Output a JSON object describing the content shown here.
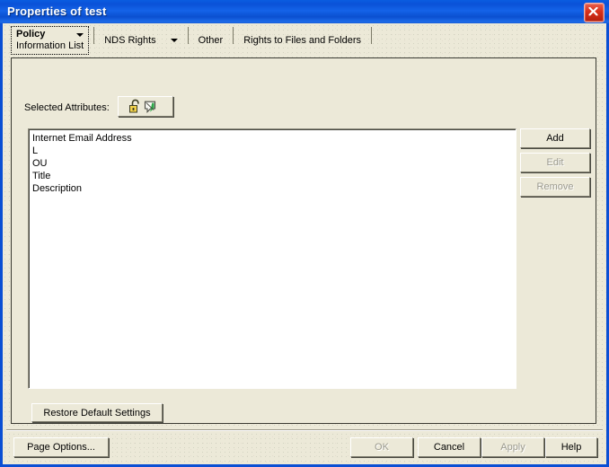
{
  "window": {
    "title": "Properties of test",
    "close_icon": "close-icon",
    "titlebar_color": "#0a52d8",
    "face_color": "#ece9d8"
  },
  "tabs": [
    {
      "label": "Policy",
      "sublabel": "Information List",
      "selected": true,
      "has_dropdown": true
    },
    {
      "label": "NDS Rights",
      "sublabel": "",
      "selected": false,
      "has_dropdown": true
    },
    {
      "label": "Other",
      "sublabel": "",
      "selected": false,
      "has_dropdown": false
    },
    {
      "label": "Rights to Files and Folders",
      "sublabel": "",
      "selected": false,
      "has_dropdown": false
    }
  ],
  "page": {
    "attributes_label": "Selected Attributes:",
    "attributes_icon": "unlocked-padlock-and-trustee-icon",
    "list_items": [
      "Internet Email Address",
      "L",
      "OU",
      "Title",
      "Description"
    ],
    "side_buttons": [
      {
        "label": "Add",
        "enabled": true
      },
      {
        "label": "Edit",
        "enabled": false
      },
      {
        "label": "Remove",
        "enabled": false
      }
    ],
    "restore_button": {
      "label": "Restore Default Settings",
      "enabled": true
    }
  },
  "footer": {
    "buttons": [
      {
        "label": "Page Options...",
        "enabled": true
      },
      {
        "label": "OK",
        "enabled": false
      },
      {
        "label": "Cancel",
        "enabled": true
      },
      {
        "label": "Apply",
        "enabled": false
      },
      {
        "label": "Help",
        "enabled": true
      }
    ]
  }
}
